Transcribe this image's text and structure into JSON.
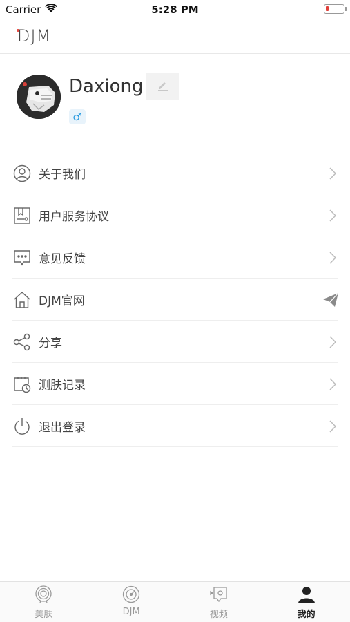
{
  "status_bar": {
    "carrier": "Carrier",
    "time": "5:28 PM"
  },
  "header": {
    "logo_text": "DJM"
  },
  "profile": {
    "username": "Daxiong",
    "gender_symbol": "♂"
  },
  "menu": {
    "items": [
      {
        "label": "关于我们",
        "icon": "user-circle-icon",
        "trailing": "chevron-right-icon"
      },
      {
        "label": "用户服务协议",
        "icon": "document-icon",
        "trailing": "chevron-right-icon"
      },
      {
        "label": "意见反馈",
        "icon": "chat-bubble-icon",
        "trailing": "chevron-right-icon"
      },
      {
        "label": "DJM官网",
        "icon": "home-icon",
        "trailing": "paper-plane-icon"
      },
      {
        "label": "分享",
        "icon": "share-icon",
        "trailing": "chevron-right-icon"
      },
      {
        "label": "测肤记录",
        "icon": "calendar-clock-icon",
        "trailing": "chevron-right-icon"
      },
      {
        "label": "退出登录",
        "icon": "power-icon",
        "trailing": "chevron-right-icon"
      }
    ]
  },
  "tab_bar": {
    "tabs": [
      {
        "label": "美肤",
        "icon": "skin-target-icon",
        "active": false
      },
      {
        "label": "DJM",
        "icon": "gauge-icon",
        "active": false
      },
      {
        "label": "视频",
        "icon": "video-icon",
        "active": false
      },
      {
        "label": "我的",
        "icon": "person-icon",
        "active": true
      }
    ]
  },
  "colors": {
    "accent_blue": "#2a9be0",
    "battery_low": "#e0403a",
    "text_primary": "#333333",
    "divider": "#eeeeee"
  }
}
